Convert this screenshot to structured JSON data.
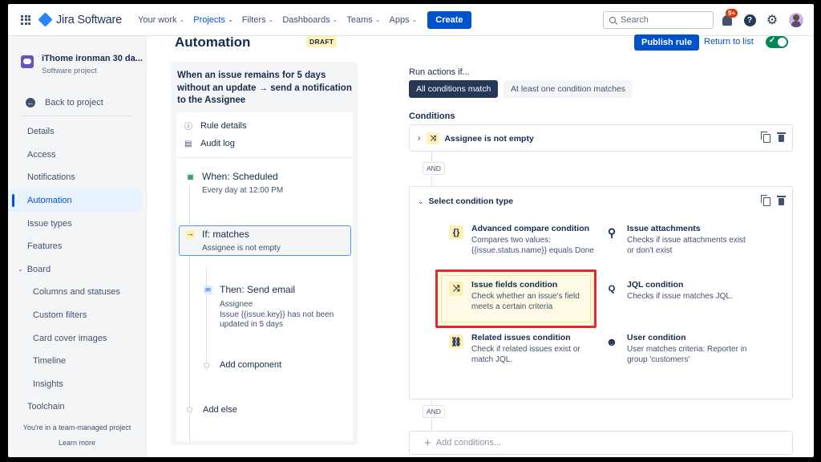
{
  "topnav": {
    "logo_text": "Jira Software",
    "items": [
      {
        "label": "Your work",
        "chev": "⌄",
        "active": false
      },
      {
        "label": "Projects",
        "chev": "⌄",
        "active": true
      },
      {
        "label": "Filters",
        "chev": "⌄",
        "active": false
      },
      {
        "label": "Dashboards",
        "chev": "⌄",
        "active": false
      },
      {
        "label": "Teams",
        "chev": "⌄",
        "active": false
      },
      {
        "label": "Apps",
        "chev": "⌄",
        "active": false
      }
    ],
    "create_label": "Create",
    "search_placeholder": "Search",
    "notification_badge": "9+",
    "help_label": "?"
  },
  "sidebar": {
    "project_name": "iThome ironman 30 da...",
    "project_type": "Software project",
    "back_label": "Back to project",
    "items": [
      {
        "label": "Details"
      },
      {
        "label": "Access"
      },
      {
        "label": "Notifications"
      },
      {
        "label": "Automation"
      },
      {
        "label": "Issue types"
      },
      {
        "label": "Features"
      },
      {
        "label": "Board"
      },
      {
        "label": "Columns and statuses"
      },
      {
        "label": "Custom filters"
      },
      {
        "label": "Card cover images"
      },
      {
        "label": "Timeline"
      },
      {
        "label": "Insights"
      },
      {
        "label": "Toolchain"
      }
    ],
    "footer_text": "You're in a team-managed project",
    "learn_more": "Learn more"
  },
  "header": {
    "title": "Automation",
    "draft_badge": "DRAFT",
    "publish_label": "Publish rule",
    "return_label": "Return to list"
  },
  "rule": {
    "title": "When an issue remains for 5 days without an update → send a notification to the Assignee",
    "rule_details": "Rule details",
    "audit_log": "Audit log",
    "when_title": "When: Scheduled",
    "when_desc": "Every day at 12:00 PM",
    "if_title": "If: matches",
    "if_desc": "Assignee is not empty",
    "then_title": "Then: Send email",
    "then_desc_1": "Assignee",
    "then_desc_2": "Issue {{issue.key}} has not been updated in 5 days",
    "add_component": "Add component",
    "add_else": "Add else"
  },
  "conditions": {
    "run_label": "Run actions if...",
    "all_match": "All conditions match",
    "one_match": "At least one condition matches",
    "section_label": "Conditions",
    "existing_condition": "Assignee is not empty",
    "and_label": "AND",
    "select_label": "Select condition type",
    "options": [
      {
        "title": "Advanced compare condition",
        "desc": "Compares two values: {{issue.status.name}} equals Done",
        "icon": "{}"
      },
      {
        "title": "Issue attachments",
        "desc": "Checks if issue attachments exist or don't exist",
        "icon": "⚲"
      },
      {
        "title": "Issue fields condition",
        "desc": "Check whether an issue's field meets a certain criteria",
        "icon": "⤨"
      },
      {
        "title": "JQL condition",
        "desc": "Checks if issue matches JQL.",
        "icon": "Q"
      },
      {
        "title": "Related issues condition",
        "desc": "Check if related issues exist or match JQL.",
        "icon": "⛓"
      },
      {
        "title": "User condition",
        "desc": "User matches criteria: Reporter in group 'customers'",
        "icon": "☻"
      }
    ],
    "add_conditions": "Add conditions..."
  },
  "colors": {
    "accent": "#0052cc",
    "highlight_border": "#e5282b",
    "toggle_on": "#00875a"
  }
}
